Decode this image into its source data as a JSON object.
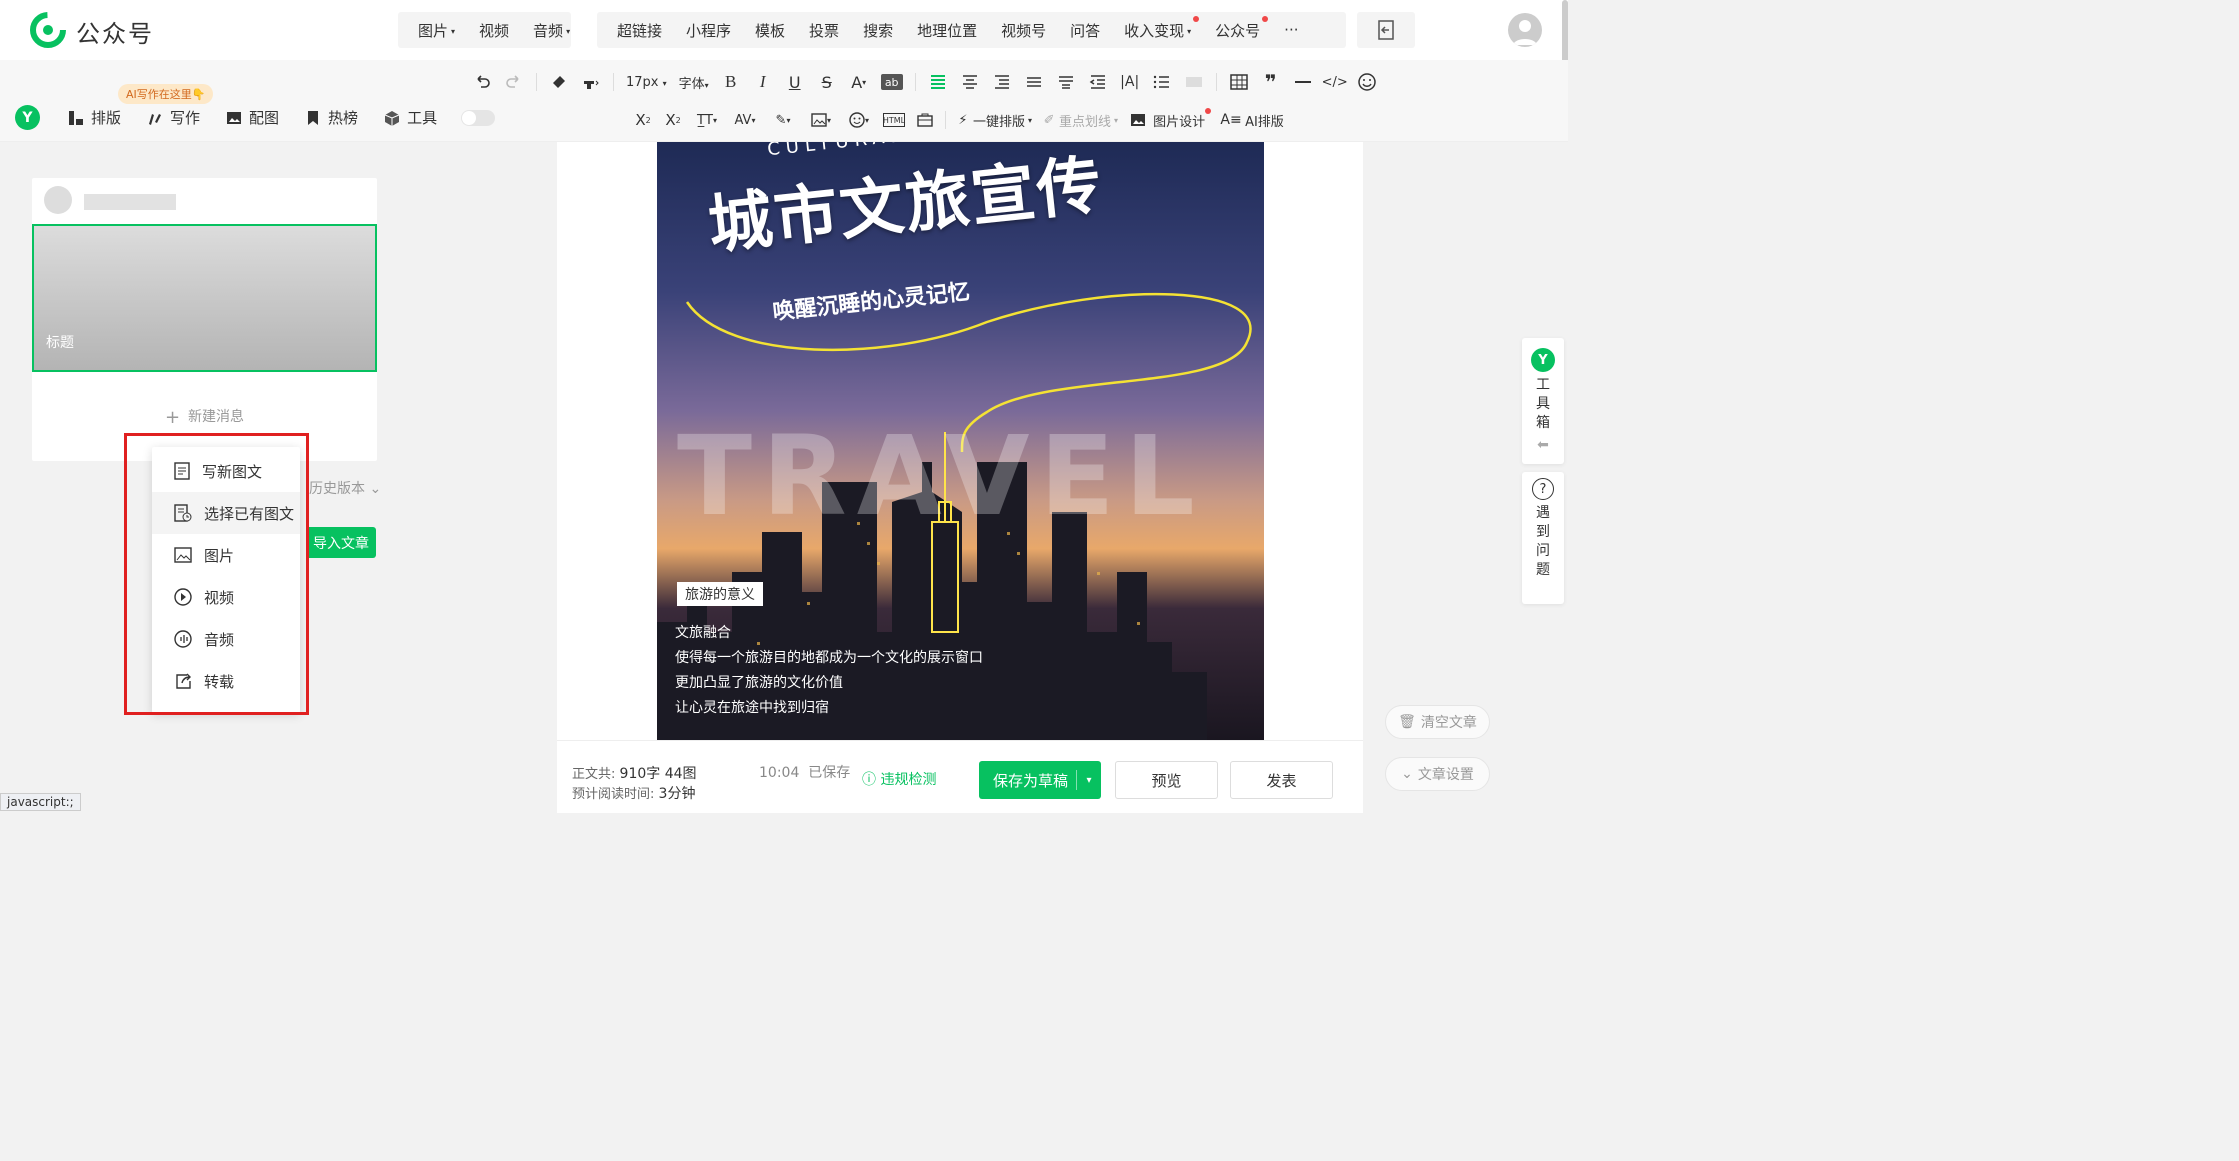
{
  "header": {
    "brand": "公众号",
    "nav_group1": [
      "图片",
      "视频",
      "音频"
    ],
    "nav_group2": [
      "超链接",
      "小程序",
      "模板",
      "投票",
      "搜索",
      "地理位置",
      "视频号",
      "问答",
      "收入变现",
      "公众号",
      "···"
    ]
  },
  "toolbar": {
    "font_size": "17px",
    "font_label": "字体",
    "left_buttons": [
      "排版",
      "写作",
      "配图",
      "热榜",
      "工具"
    ],
    "ai_tag": "AI写作在这里👇",
    "one_click": "一键排版",
    "highlight": "重点划线",
    "image_design": "图片设计",
    "ai_layout": "AI排版"
  },
  "left": {
    "cover_title": "标题",
    "new_message": "新建消息",
    "history": "历史版本",
    "import": "导入文章"
  },
  "dropdown": {
    "items": [
      "写新图文",
      "选择已有图文",
      "图片",
      "视频",
      "音频",
      "转载"
    ]
  },
  "poster": {
    "top_text": "CULTURAL",
    "title": "城市文旅宣传",
    "subtitle": "唤醒沉睡的心灵记忆",
    "watermark": "TRAVEL",
    "label": "旅游的意义",
    "lines": [
      "文旅融合",
      "使得每一个旅游目的地都成为一个文化的展示窗口",
      "更加凸显了旅游的文化价值",
      "让心灵在旅途中找到归宿"
    ]
  },
  "status": {
    "body_label": "正文共:",
    "body_value": "910字 44图",
    "read_label": "预计阅读时间:",
    "read_value": "3分钟",
    "time": "10:04",
    "saved": "已保存",
    "check": "违规检测",
    "save_draft": "保存为草稿",
    "preview": "预览",
    "publish": "发表"
  },
  "side": {
    "toolbox": "工具箱",
    "problem": "遇到问题",
    "clear": "清空文章",
    "settings": "文章设置"
  },
  "browser_status": "javascript:;"
}
